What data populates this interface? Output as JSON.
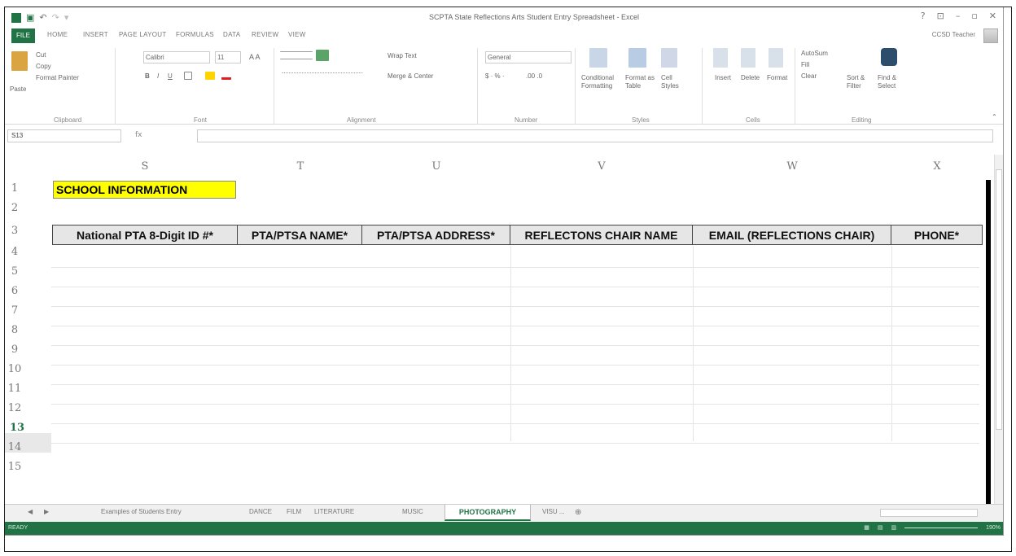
{
  "window": {
    "title": "SCPTA State Reflections Arts Student Entry Spreadsheet - Excel",
    "controls": [
      "?",
      "⊡",
      "–",
      "▫",
      "✕"
    ]
  },
  "qat": {
    "save_icon": "save-icon",
    "undo_icon": "undo-icon",
    "redo_icon": "redo-icon"
  },
  "ribbon_tabs": {
    "file": "FILE",
    "items": [
      "HOME",
      "INSERT",
      "PAGE LAYOUT",
      "FORMULAS",
      "DATA",
      "REVIEW",
      "VIEW"
    ],
    "user": "CCSD Teacher"
  },
  "ribbon": {
    "clipboard": {
      "paste": "Paste",
      "cut": "Cut",
      "copy": "Copy",
      "format_painter": "Format Painter",
      "label": "Clipboard"
    },
    "font": {
      "name": "Calibri",
      "size": "11",
      "bold": "B",
      "italic": "I",
      "underline": "U",
      "label": "Font"
    },
    "alignment": {
      "wrap": "Wrap Text",
      "merge": "Merge & Center",
      "label": "Alignment"
    },
    "number": {
      "format": "General",
      "label": "Number"
    },
    "styles": {
      "conditional": "Conditional Formatting",
      "format_table": "Format as Table",
      "cell_styles": "Cell Styles",
      "label": "Styles"
    },
    "cells": {
      "insert": "Insert",
      "delete": "Delete",
      "format": "Format",
      "label": "Cells"
    },
    "editing": {
      "autosum": "AutoSum",
      "fill": "Fill",
      "clear": "Clear",
      "sort": "Sort & Filter",
      "find": "Find & Select",
      "label": "Editing"
    }
  },
  "formula_bar": {
    "name_box": "S13",
    "fx": "fx",
    "value": ""
  },
  "grid": {
    "columns": [
      "S",
      "T",
      "U",
      "V",
      "W",
      "X"
    ],
    "rows": [
      "1",
      "2",
      "3",
      "4",
      "5",
      "6",
      "7",
      "8",
      "9",
      "10",
      "11",
      "12",
      "13",
      "14",
      "15"
    ],
    "selected_row": "13",
    "school_info": "SCHOOL INFORMATION",
    "headers": [
      "National PTA 8-Digit ID #*",
      "PTA/PTSA NAME*",
      "PTA/PTSA ADDRESS*",
      "REFLECTONS CHAIR NAME",
      "EMAIL (REFLECTIONS CHAIR)",
      "PHONE*"
    ]
  },
  "sheet_tabs": {
    "items": [
      "Examples of Students Entry",
      "DANCE",
      "FILM",
      "LITERATURE",
      "MUSIC"
    ],
    "active": "PHOTOGRAPHY",
    "after": "VISU ..."
  },
  "status": {
    "ready": "READY",
    "zoom": "190%"
  },
  "colors": {
    "excel_green": "#217346",
    "highlight": "#ffff00",
    "header_fill": "#e6e6e6"
  }
}
